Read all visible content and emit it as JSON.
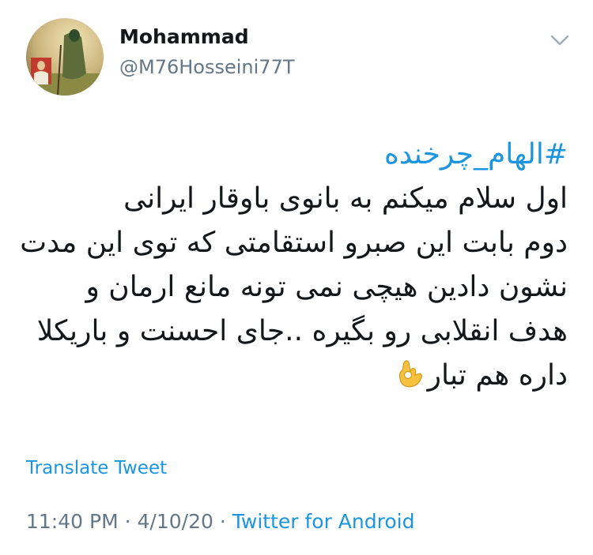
{
  "author": {
    "name": "Mohammad",
    "handle": "@M76Hosseini77T",
    "avatar_icon": "profile-avatar"
  },
  "menu": {
    "icon": "chevron-down-icon"
  },
  "tweet": {
    "hashtag": "#الهام_چرخنده",
    "lines": [
      "اول سلام میکنم به بانوی باوقار ایرانی",
      "دوم بابت این صبرو استقامتی که توی این مدت",
      "نشون دادین هیچی نمی تونه مانع ارمان و",
      "هدف انقلابی رو بگیره ..جای احسنت و باریکلا",
      "داره هم تبار"
    ],
    "emoji": "ok-hand-emoji"
  },
  "translate_label": "Translate Tweet",
  "meta": {
    "time": "11:40 PM",
    "separator_1": "·",
    "date": "4/10/20",
    "separator_2": "·",
    "source": "Twitter for Android"
  },
  "colors": {
    "link": "#1b95e0",
    "text": "#14171a",
    "secondary": "#657786"
  }
}
